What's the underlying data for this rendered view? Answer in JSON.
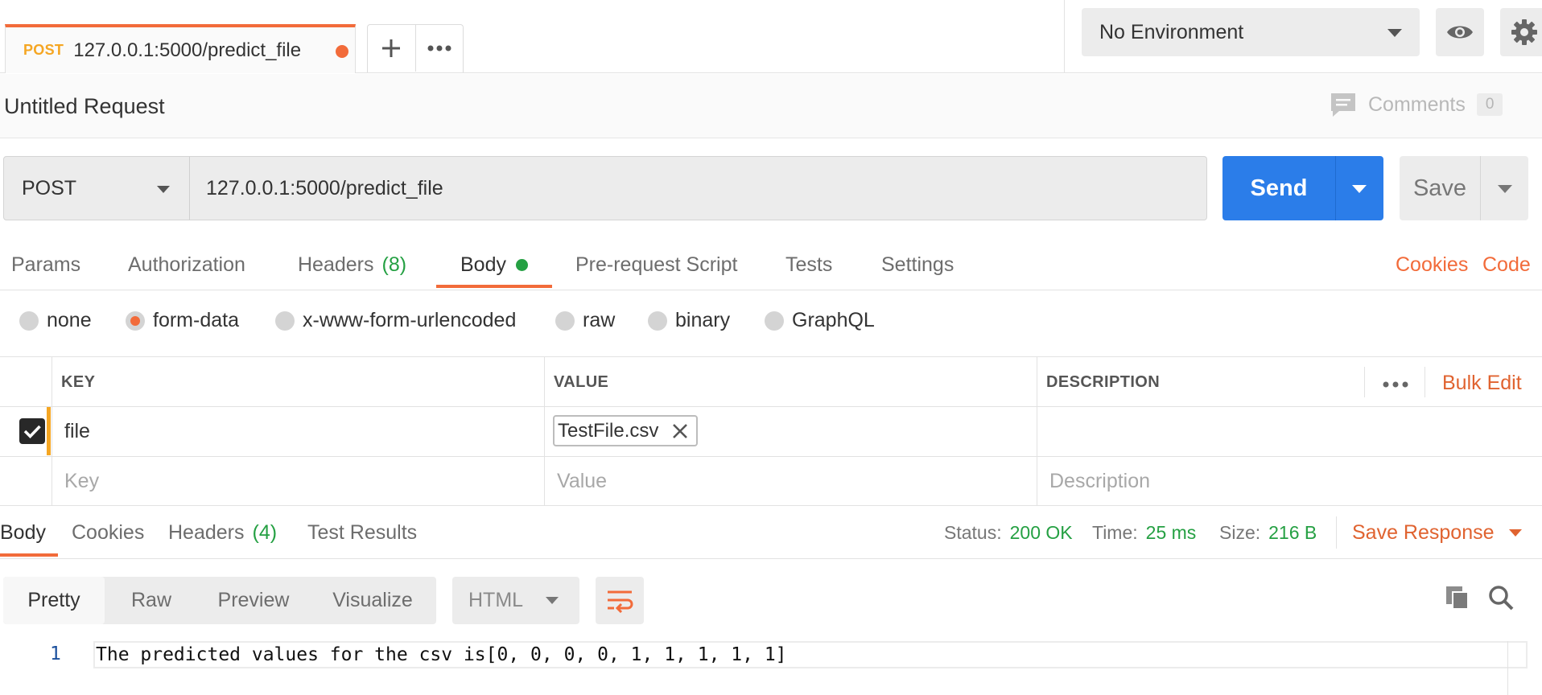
{
  "request_tab": {
    "method": "POST",
    "url": "127.0.0.1:5000/predict_file"
  },
  "environment": {
    "selected": "No Environment"
  },
  "title": {
    "name": "Untitled Request",
    "comments_label": "Comments",
    "comments_count": "0"
  },
  "url_bar": {
    "method": "POST",
    "url": "127.0.0.1:5000/predict_file",
    "send_label": "Send",
    "save_label": "Save"
  },
  "request_tabs": {
    "params": "Params",
    "authorization": "Authorization",
    "headers": "Headers",
    "headers_count": "(8)",
    "body": "Body",
    "pre_request": "Pre-request Script",
    "tests": "Tests",
    "settings": "Settings",
    "cookies": "Cookies",
    "code": "Code"
  },
  "body_types": [
    "none",
    "form-data",
    "x-www-form-urlencoded",
    "raw",
    "binary",
    "GraphQL"
  ],
  "body_type_selected": "form-data",
  "table": {
    "headers": {
      "key": "KEY",
      "value": "VALUE",
      "description": "DESCRIPTION"
    },
    "bulk_edit": "Bulk Edit",
    "row": {
      "key": "file",
      "file": "TestFile.csv"
    },
    "placeholders": {
      "key": "Key",
      "value": "Value",
      "description": "Description"
    }
  },
  "response_tabs": {
    "body": "Body",
    "cookies": "Cookies",
    "headers": "Headers",
    "headers_count": "(4)",
    "test_results": "Test Results"
  },
  "response_stats": {
    "status_label": "Status:",
    "status": "200 OK",
    "time_label": "Time:",
    "time": "25 ms",
    "size_label": "Size:",
    "size": "216 B",
    "save_response": "Save Response"
  },
  "format": {
    "options": [
      "Pretty",
      "Raw",
      "Preview",
      "Visualize"
    ],
    "selected": "Pretty",
    "language": "HTML"
  },
  "response_body": {
    "line_number": "1",
    "text": "The predicted values for the csv is[0, 0, 0, 0, 1, 1, 1, 1, 1]"
  },
  "colors": {
    "accent": "#f26b3a",
    "send": "#2b7de9",
    "success": "#25a043",
    "method_tab": "#f5a623"
  }
}
